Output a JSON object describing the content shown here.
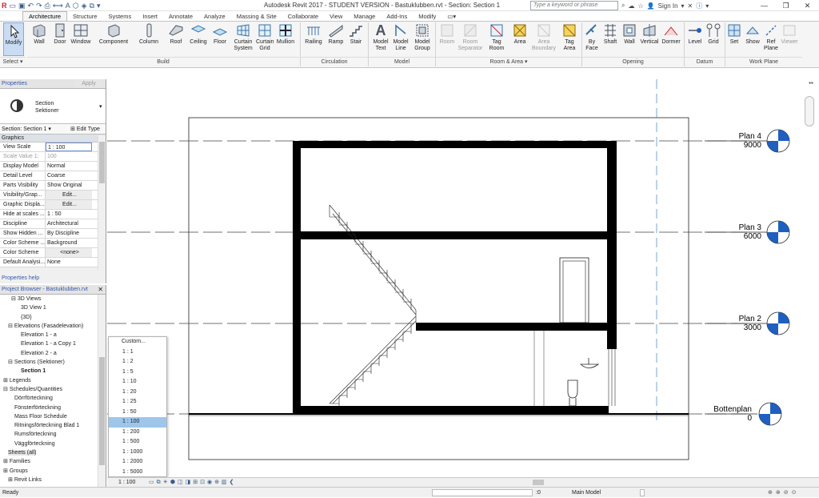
{
  "title": "Autodesk Revit 2017 - STUDENT VERSION -    Bastuklubben.rvt - Section: Section 1",
  "search_placeholder": "Type a keyword or phrase",
  "sign_in": "Sign In",
  "tabs": [
    "Architecture",
    "Structure",
    "Systems",
    "Insert",
    "Annotate",
    "Analyze",
    "Massing & Site",
    "Collaborate",
    "View",
    "Manage",
    "Add-Ins",
    "Modify"
  ],
  "ribbon": {
    "modify": "Modify",
    "build": [
      "Wall",
      "Door",
      "Window",
      "Component",
      "Column",
      "Roof",
      "Ceiling",
      "Floor",
      "Curtain System",
      "Curtain Grid",
      "Mullion"
    ],
    "circulation": [
      "Railing",
      "Ramp",
      "Stair"
    ],
    "model": [
      "Model Text",
      "Model Line",
      "Model Group"
    ],
    "room": [
      "Room",
      "Room Separator",
      "Tag Room",
      "Area",
      "Area Boundary",
      "Tag Area"
    ],
    "opening": [
      "By Face",
      "Shaft",
      "Wall",
      "Vertical",
      "Dormer"
    ],
    "datum": [
      "Level",
      "Grid"
    ],
    "workplane": [
      "Set",
      "Show",
      "Ref Plane",
      "Viewer"
    ],
    "panels": {
      "select": "Select",
      "build": "Build",
      "circulation": "Circulation",
      "model": "Model",
      "room": "Room & Area",
      "opening": "Opening",
      "datum": "Datum",
      "workplane": "Work Plane"
    }
  },
  "properties": {
    "header": "Properties",
    "type_name": "Section",
    "type_sub": "Sektioner",
    "instance": "Section: Section 1",
    "edit_type": "Edit Type",
    "group": "Graphics",
    "rows": [
      {
        "k": "View Scale",
        "v": "1 : 100"
      },
      {
        "k": "Scale Value  1:",
        "v": "100"
      },
      {
        "k": "Display Model",
        "v": "Normal"
      },
      {
        "k": "Detail Level",
        "v": "Coarse"
      },
      {
        "k": "Parts Visibility",
        "v": "Show Original"
      },
      {
        "k": "Visibility/Grap...",
        "v": "Edit..."
      },
      {
        "k": "Graphic Displa...",
        "v": "Edit..."
      },
      {
        "k": "Hide at scales ...",
        "v": "1 : 50"
      },
      {
        "k": "Discipline",
        "v": "Architectural"
      },
      {
        "k": "Show Hidden ...",
        "v": "By Discipline"
      },
      {
        "k": "Color Scheme ...",
        "v": "Background"
      },
      {
        "k": "Color Scheme",
        "v": "<none>"
      },
      {
        "k": "Default Analysi...",
        "v": "None"
      }
    ],
    "help": "Properties help",
    "apply": "Apply"
  },
  "browser": {
    "header": "Project Browser - Bastuklubben.rvt",
    "items": [
      "3D Views",
      "3D View 1",
      "{3D}",
      "Elevations (Fasadelevation)",
      "Elevation 1 - a",
      "Elevation 1 - a Copy 1",
      "Elevation 2 - a",
      "Sections (Sektioner)",
      "Section 1",
      "Legends",
      "Schedules/Quantities",
      "Dörrförteckning",
      "Fönsterförteckning",
      "Mass Floor Schedule",
      "Ritningsförteckning Blad 1",
      "Rumsförteckning",
      "Väggförteckning",
      "Sheets (all)",
      "Families",
      "Groups",
      "Revit Links"
    ]
  },
  "scale_menu": [
    "Custom...",
    "1 : 1",
    "1 : 2",
    "1 : 5",
    "1 : 10",
    "1 : 20",
    "1 : 25",
    "1 : 50",
    "1 : 100",
    "1 : 200",
    "1 : 500",
    "1 : 1000",
    "1 : 2000",
    "1 : 5000"
  ],
  "levels": [
    {
      "name": "Plan 4",
      "elev": "9000"
    },
    {
      "name": "Plan 3",
      "elev": "6000"
    },
    {
      "name": "Plan 2",
      "elev": "3000"
    },
    {
      "name": "Bottenplan",
      "elev": "0"
    }
  ],
  "viewbar_scale": "1 : 100",
  "status": {
    "ready": "Ready",
    "zero": ":0",
    "model": "Main Model"
  },
  "colors": {
    "selected": "#9dc6ea",
    "ribbon_bg": "#f5f5f5",
    "level_blue": "#1f5fbf"
  }
}
